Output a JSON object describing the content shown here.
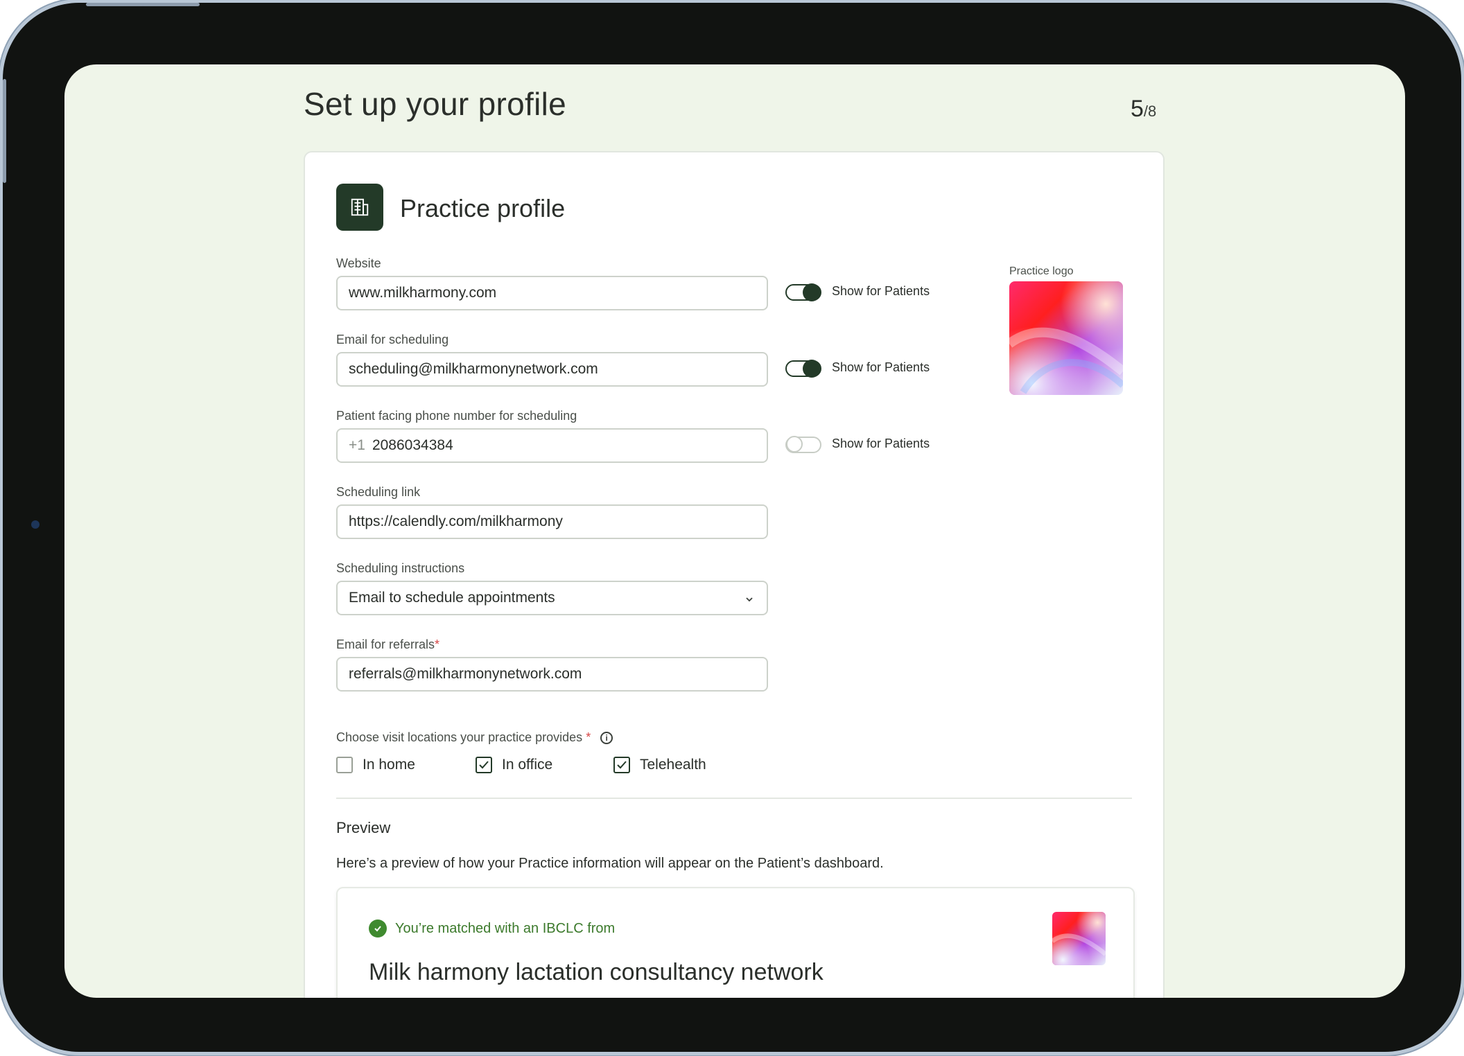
{
  "page": {
    "title": "Set up your profile",
    "step_current": "5",
    "step_total": "/8"
  },
  "section": {
    "title": "Practice profile",
    "icon": "building-icon"
  },
  "fields": {
    "website": {
      "label": "Website",
      "value": "www.milkharmony.com"
    },
    "email_scheduling": {
      "label": "Email for scheduling",
      "value": "scheduling@milkharmonynetwork.com"
    },
    "phone": {
      "label": "Patient facing phone number for scheduling",
      "prefix": "+1",
      "value": "2086034384"
    },
    "scheduling_link": {
      "label": "Scheduling link",
      "value": "https://calendly.com/milkharmony"
    },
    "scheduling_instructions": {
      "label": "Scheduling instructions",
      "value": "Email to schedule appointments"
    },
    "email_referrals": {
      "label": "Email for referrals",
      "required_mark": "*",
      "value": "referrals@milkharmonynetwork.com"
    }
  },
  "toggles": [
    {
      "label": "Show for Patients",
      "on": true
    },
    {
      "label": "Show for Patients",
      "on": true
    },
    {
      "label": "Show for Patients",
      "on": false
    }
  ],
  "logo": {
    "label": "Practice logo"
  },
  "locations": {
    "label": "Choose visit locations your practice provides",
    "required_mark": "*",
    "info_icon": "info-icon",
    "options": [
      {
        "label": "In home",
        "checked": false
      },
      {
        "label": "In office",
        "checked": true
      },
      {
        "label": "Telehealth",
        "checked": true
      }
    ]
  },
  "preview": {
    "title": "Preview",
    "description": "Here’s a preview of how your Practice information will appear on the Patient’s dashboard.",
    "matched_text": "You’re matched with an IBCLC from",
    "practice_name": "Milk harmony lactation consultancy network"
  },
  "colors": {
    "brand_dark_green": "#233a28",
    "screen_bg": "#eff5e9",
    "success_green": "#3f8a2f",
    "required_red": "#d64545"
  }
}
